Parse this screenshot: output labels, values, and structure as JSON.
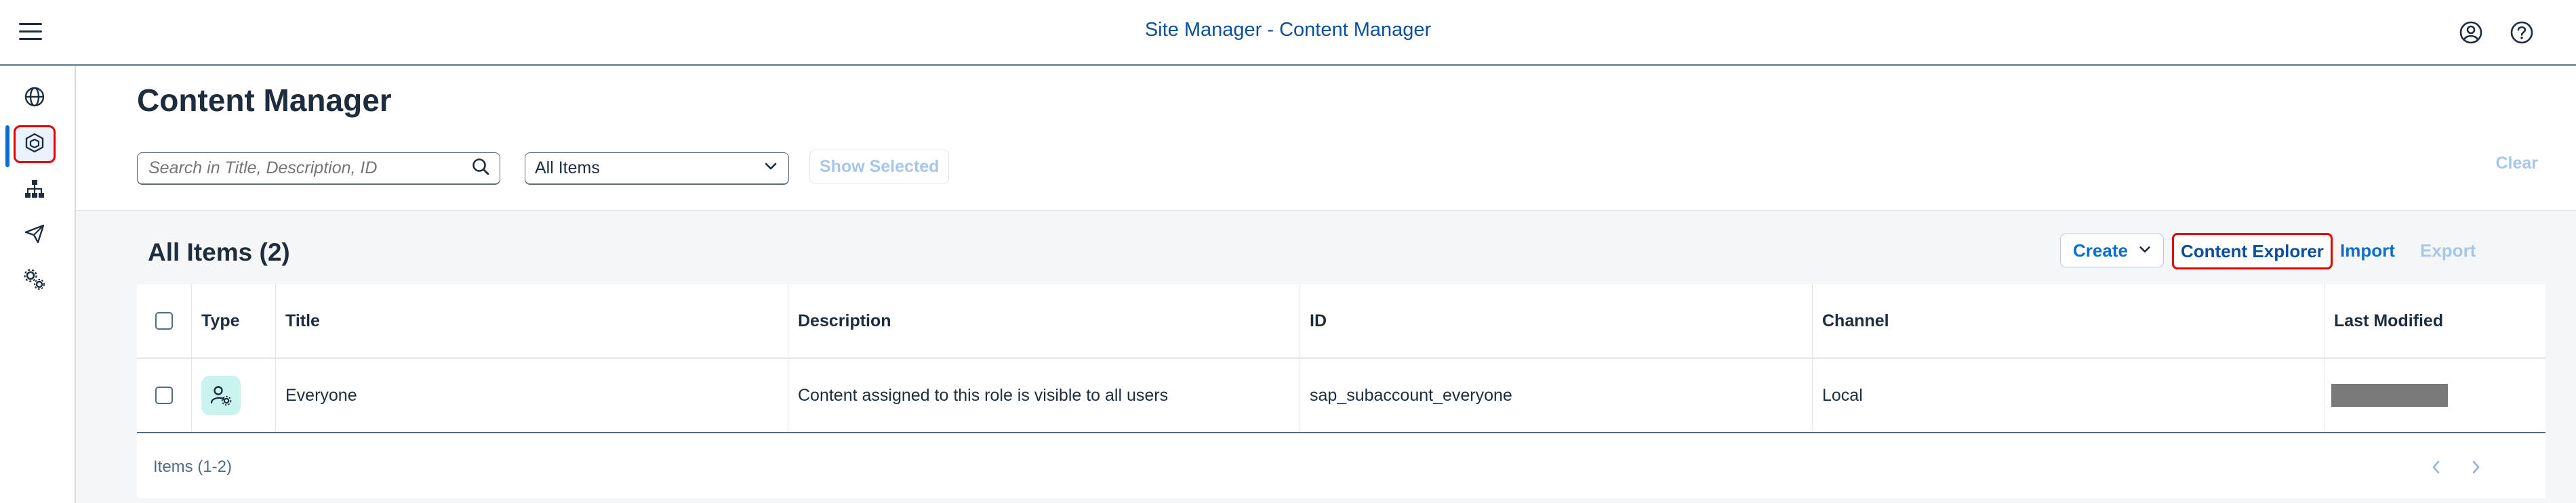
{
  "shellbar": {
    "title": "Site Manager - Content Manager",
    "icons": [
      "hamburger-menu-icon",
      "user-profile-icon",
      "help-icon"
    ]
  },
  "sidenav": {
    "items": [
      {
        "icon": "globe-icon",
        "selected": false
      },
      {
        "icon": "cube-icon",
        "selected": true
      },
      {
        "icon": "sitemap-icon",
        "selected": false
      },
      {
        "icon": "paper-plane-icon",
        "selected": false
      },
      {
        "icon": "settings-gears-icon",
        "selected": false
      }
    ]
  },
  "page": {
    "title": "Content Manager"
  },
  "filters": {
    "search_placeholder": "Search in Title, Description, ID",
    "select_value": "All Items",
    "show_selected_label": "Show Selected",
    "clear_label": "Clear"
  },
  "panel": {
    "title": "All Items (2)",
    "create_label": "Create",
    "content_explorer_label": "Content Explorer",
    "import_label": "Import",
    "export_label": "Export"
  },
  "table": {
    "columns": [
      "Type",
      "Title",
      "Description",
      "ID",
      "Channel",
      "Last Modified"
    ],
    "rows": [
      {
        "type_icon": "role-icon",
        "title": "Everyone",
        "description": "Content assigned to this role is visible to all users",
        "id": "sap_subaccount_everyone",
        "channel": "Local",
        "last_modified": ""
      }
    ],
    "footer": "Items (1-2)"
  },
  "colors": {
    "brand": "#0a6ed1",
    "title_text": "#1d2d3e",
    "highlight_border": "#e00000",
    "role_icon_bg": "#c9f3ee"
  }
}
